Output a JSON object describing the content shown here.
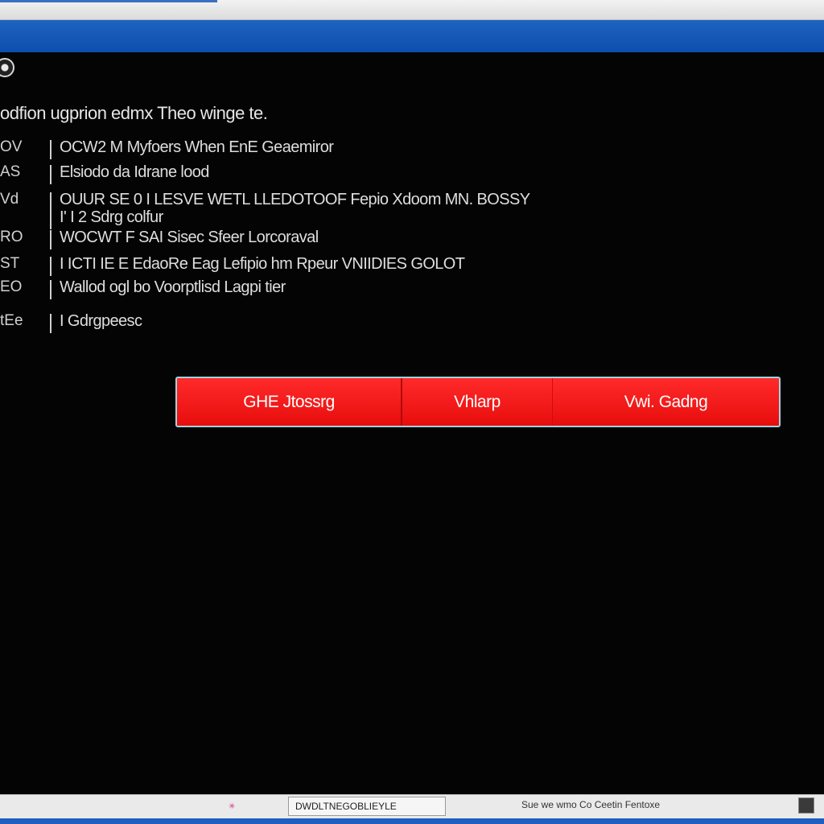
{
  "window": {
    "title": ""
  },
  "console": {
    "heading": "odfion ugprion edmx Theo winge te.",
    "rows": [
      {
        "key": "OV",
        "text": "OCW2 M Myfoers When EnE Geaemiror"
      },
      {
        "key": "AS",
        "text": "Elsiodo da Idrane lood"
      },
      {
        "key": "Vd",
        "text": "OUUR SE 0 I LESVE WETL LLEDOTOOF Fepio Xdoom MN. BOSSY"
      },
      {
        "key": "",
        "text": "I' I 2 Sdrg colfur"
      },
      {
        "key": "RO",
        "text": "WOCWT F SAI Sisec Sfeer Lorcoraval"
      },
      {
        "key": "ST",
        "text": "I ICTI IE E EdaoRe Eag Lefipio hm Rpeur VNIIDIES GOLOT"
      },
      {
        "key": "EO",
        "text": "Wallod ogl bo Voorptlisd Lagpi tier"
      },
      {
        "key": "tEe",
        "text": "I Gdrgpeesc"
      }
    ]
  },
  "actions": {
    "button1": "GHE Jtossrg",
    "button2": "Vhlarp",
    "button3": "Vwi. Gadng"
  },
  "taskbar": {
    "window_button": "DWDLTNEGOBLIEYLE",
    "tray_text": "Sue we wmo Co Ceetin Fentoxe"
  },
  "colors": {
    "title_bar": "#0c4fae",
    "console_bg": "#040404",
    "console_text": "#dedede",
    "button_red": "#f01010",
    "button_border": "#9fd3df",
    "taskbar_bg": "#eaeaea",
    "taskbar_strip": "#1f5fbf"
  },
  "icons": {
    "app": "app-icon",
    "tray": "tray-icon",
    "taskbar_mark": "sparkle-icon"
  }
}
